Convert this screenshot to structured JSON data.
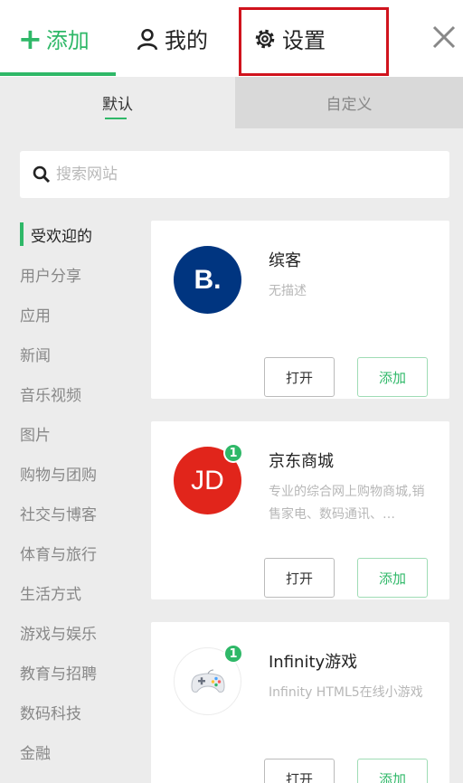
{
  "header": {
    "tabs": {
      "add": "添加",
      "mine": "我的",
      "settings": "设置"
    },
    "icons": {
      "add": "plus-icon",
      "mine": "user-icon",
      "settings": "gear-icon",
      "close": "close-icon"
    },
    "accent_color": "#2fb868",
    "highlight_color": "#d0131d"
  },
  "segments": {
    "default": "默认",
    "custom": "自定义"
  },
  "search": {
    "placeholder": "搜索网站"
  },
  "categories": [
    "受欢迎的",
    "用户分享",
    "应用",
    "新闻",
    "音乐视频",
    "图片",
    "购物与团购",
    "社交与博客",
    "体育与旅行",
    "生活方式",
    "游戏与娱乐",
    "教育与招聘",
    "数码科技",
    "金融"
  ],
  "cards": [
    {
      "name": "缤客",
      "description": "无描述",
      "open_label": "打开",
      "add_label": "添加",
      "logo_text": "B.",
      "logo_color": "#003580",
      "badge": ""
    },
    {
      "name": "京东商城",
      "description": "专业的综合网上购物商城,销售家电、数码通讯、…",
      "open_label": "打开",
      "add_label": "添加",
      "logo_text": "JD",
      "logo_color": "#e1251b",
      "badge": "1"
    },
    {
      "name": "Infinity游戏",
      "description": "Infinity HTML5在线小游戏",
      "open_label": "打开",
      "add_label": "添加",
      "logo_icon": "gamepad-icon",
      "badge": "1"
    }
  ]
}
